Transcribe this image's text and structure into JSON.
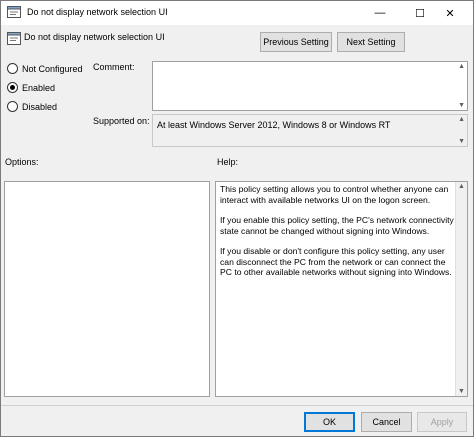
{
  "window": {
    "title": "Do not display network selection UI",
    "minimize_glyph": "—",
    "maximize_glyph": "☐",
    "close_glyph": "✕"
  },
  "header": {
    "policy_name": "Do not display network selection UI",
    "previous_label": "Previous Setting",
    "next_label": "Next Setting"
  },
  "state": {
    "options": [
      {
        "label": "Not Configured",
        "selected": false
      },
      {
        "label": "Enabled",
        "selected": true
      },
      {
        "label": "Disabled",
        "selected": false
      }
    ]
  },
  "comment": {
    "label": "Comment:",
    "value": ""
  },
  "supported": {
    "label": "Supported on:",
    "value": "At least Windows Server 2012, Windows 8 or Windows RT"
  },
  "options_pane": {
    "label": "Options:"
  },
  "help_pane": {
    "label": "Help:",
    "paragraphs": [
      "This policy setting allows you to control whether anyone can interact with available networks UI on the logon screen.",
      "If you enable this policy setting, the PC's network connectivity state cannot be changed without signing into Windows.",
      "If you disable or don't configure this policy setting, any user can disconnect the PC from the network or can connect the PC to other available networks without signing into Windows."
    ]
  },
  "footer": {
    "ok_label": "OK",
    "cancel_label": "Cancel",
    "apply_label": "Apply"
  }
}
